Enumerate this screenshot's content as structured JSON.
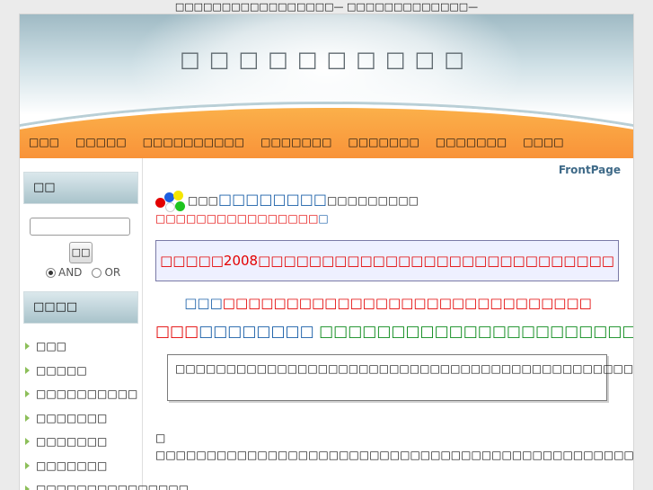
{
  "top_line": "□□□□□□□□□□□□□□□□□— □□□□□□□□□□□□□—",
  "site_title": "□□□□□□□□□□",
  "nav": [
    "□□□",
    "□□□□□",
    "□□□□□□□□□□",
    "□□□□□□□",
    "□□□□□□□",
    "□□□□□□□",
    "□□□□"
  ],
  "sidebar": {
    "search_title": "□□",
    "search_button": "□□",
    "radio_and": "AND",
    "radio_or": "OR",
    "menu_title": "□□□□",
    "menu_items": [
      "□□□",
      "□□□□□",
      "□□□□□□□□□□",
      "□□□□□□□",
      "□□□□□□□",
      "□□□□□□□",
      "□□□□□□□□□□□□□□□"
    ]
  },
  "main": {
    "page_label": "FrontPage",
    "intro_prefix": "□□□",
    "intro_link": "□□□□□□□□",
    "intro_suffix": "□□□□□□□□□",
    "intro_red": "□□□□□□□□□□□□□□□□",
    "intro_red_tail": "□",
    "notice": "□□□□□2008□□□□□□□□□□□□□□□□□□□□□□□□□□□□",
    "center_blue": "□□□",
    "center_red": "□□□□□□□□□□□□□□□□□□□□□□□□□□□□□",
    "h2_red": "□□□",
    "h2_navy": "□□□□□□□□",
    "h2_green": "□□□□□□□□□□□□□□□□□□□□□□□□□□",
    "box_text": "□□□□□□□□□□□□□□□□□□□□□□□□□□□□□□□□□□□□□□□□□□□□□□□□□□□□□□□□□□□□□□□□□□□□□",
    "para1": "□",
    "para2": "□□□□□□□□□□□□□□□□□□□□□□□□□□□□□□□□□□□□□□□□□□□□□□□□□□□□□□□□□□□□□□□□□□□□□□",
    "para3": "□□□□□□□□□□□□□□□□□□□□□□□□□□□□□□□□□□□□□□□□",
    "colors": {
      "red": "#e30000",
      "blue": "#1a5fa8",
      "green": "#0f8c1e",
      "orange": "#f7822f"
    }
  }
}
